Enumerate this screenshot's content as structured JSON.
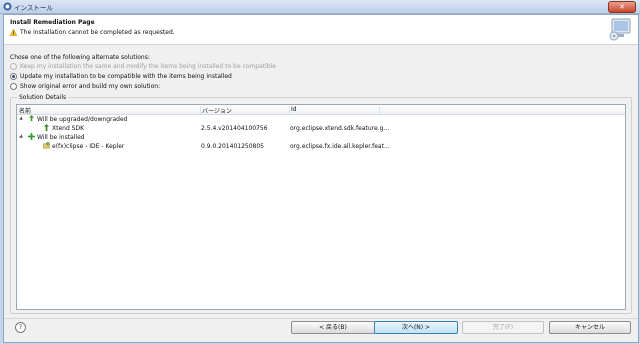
{
  "window": {
    "title": "インストール"
  },
  "header": {
    "title": "Install Remediation Page",
    "message": "The installation cannot be completed as requested."
  },
  "options": {
    "prompt": "Chose one of the following alternate solutions:",
    "items": [
      {
        "label": "Keep my installation the same and modify the items being installed to be compatible",
        "checked": false,
        "enabled": false
      },
      {
        "label": "Update my installation to be compatible with the items being installed",
        "checked": true,
        "enabled": true
      },
      {
        "label": "Show original error and build my own solution:",
        "checked": false,
        "enabled": true
      }
    ]
  },
  "details": {
    "group_label": "Solution Details",
    "columns": [
      "名前",
      "バージョン",
      "Id"
    ],
    "rows": [
      {
        "name": "Will be upgraded/downgraded",
        "version": "",
        "id": "",
        "level": 0,
        "icon": "upgrade-group-icon"
      },
      {
        "name": "Xtend SDK",
        "version": "2.5.4.v201404100756",
        "id": "org.eclipse.xtend.sdk.feature.g...",
        "level": 1,
        "icon": "upgrade-arrow-icon"
      },
      {
        "name": "Will be installed",
        "version": "",
        "id": "",
        "level": 0,
        "icon": "install-group-icon"
      },
      {
        "name": "e(fx)clipse - IDE - Kepler",
        "version": "0.9.0.201401250805",
        "id": "org.eclipse.fx.ide.all.kepler.feat...",
        "level": 1,
        "icon": "feature-icon"
      }
    ]
  },
  "buttons": {
    "back": "< 戻る(B)",
    "next": "次へ(N) >",
    "finish": "完了(F)",
    "cancel": "キャンセル"
  },
  "help": "?"
}
